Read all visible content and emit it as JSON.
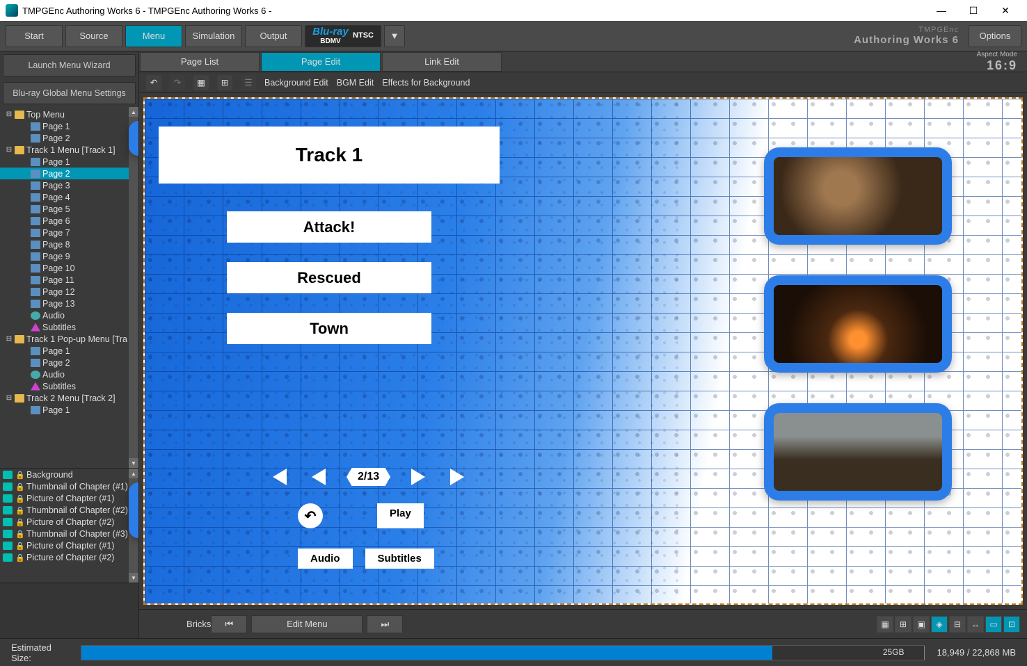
{
  "window": {
    "title": "TMPGEnc Authoring Works 6 - TMPGEnc Authoring Works 6 -"
  },
  "toolbar": {
    "start": "Start",
    "source": "Source",
    "menu": "Menu",
    "simulation": "Simulation",
    "output": "Output",
    "format_l1": "Blu-ray",
    "format_l2": "BDMV",
    "format_system": "NTSC",
    "brand_small": "TMPGEnc",
    "brand_big": "Authoring Works 6",
    "options": "Options"
  },
  "left": {
    "wizard": "Launch Menu Wizard",
    "global": "Blu-ray Global Menu Settings"
  },
  "tree": [
    {
      "type": "folder",
      "label": "Top Menu",
      "children": [
        {
          "type": "page",
          "label": "Page 1"
        },
        {
          "type": "page",
          "label": "Page 2"
        }
      ]
    },
    {
      "type": "folder",
      "label": "Track 1 Menu [Track 1]",
      "children": [
        {
          "type": "page",
          "label": "Page 1"
        },
        {
          "type": "page",
          "label": "Page 2",
          "sel": true
        },
        {
          "type": "page",
          "label": "Page 3"
        },
        {
          "type": "page",
          "label": "Page 4"
        },
        {
          "type": "page",
          "label": "Page 5"
        },
        {
          "type": "page",
          "label": "Page 6"
        },
        {
          "type": "page",
          "label": "Page 7"
        },
        {
          "type": "page",
          "label": "Page 8"
        },
        {
          "type": "page",
          "label": "Page 9"
        },
        {
          "type": "page",
          "label": "Page 10"
        },
        {
          "type": "page",
          "label": "Page 11"
        },
        {
          "type": "page",
          "label": "Page 12"
        },
        {
          "type": "page",
          "label": "Page 13"
        },
        {
          "type": "audio",
          "label": "Audio"
        },
        {
          "type": "sub",
          "label": "Subtitles"
        }
      ]
    },
    {
      "type": "folder",
      "label": "Track 1 Pop-up Menu [Tra",
      "children": [
        {
          "type": "page",
          "label": "Page 1"
        },
        {
          "type": "page",
          "label": "Page 2"
        },
        {
          "type": "audio",
          "label": "Audio"
        },
        {
          "type": "sub",
          "label": "Subtitles"
        }
      ]
    },
    {
      "type": "folder",
      "label": "Track 2 Menu [Track 2]",
      "children": [
        {
          "type": "page",
          "label": "Page 1"
        }
      ]
    }
  ],
  "layers": [
    {
      "locked": true,
      "label": "Background"
    },
    {
      "locked": true,
      "label": "Thumbnail of Chapter (#1)"
    },
    {
      "locked": true,
      "label": "Picture of Chapter (#1)"
    },
    {
      "locked": true,
      "label": "Thumbnail of Chapter (#2)"
    },
    {
      "locked": true,
      "label": "Picture of Chapter (#2)"
    },
    {
      "locked": true,
      "label": "Thumbnail of Chapter (#3)"
    },
    {
      "locked": true,
      "label": "Picture of Chapter (#1)"
    },
    {
      "locked": true,
      "label": "Picture of Chapter (#2)"
    }
  ],
  "subtabs": {
    "page_list": "Page List",
    "page_edit": "Page Edit",
    "link_edit": "Link Edit"
  },
  "aspect": {
    "label": "Aspect Mode",
    "value": "16:9"
  },
  "edittb": {
    "bg": "Background Edit",
    "bgm": "BGM Edit",
    "fx": "Effects for Background"
  },
  "stage": {
    "title": "Track 1",
    "items": [
      "Attack!",
      "Rescued",
      "Town"
    ],
    "page_ind": "2/13",
    "play": "Play",
    "audio": "Audio",
    "subtitles": "Subtitles"
  },
  "bottom": {
    "theme": "Bricks",
    "edit_menu": "Edit Menu"
  },
  "status": {
    "label": "Estimated Size:",
    "target": "25GB",
    "used": "18,949 / 22,868 MB"
  }
}
